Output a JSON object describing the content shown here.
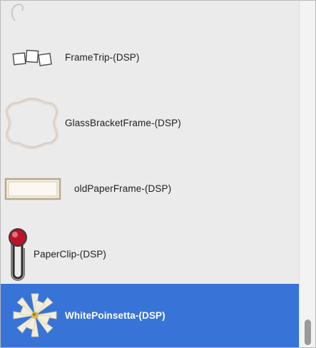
{
  "list": {
    "items": [
      {
        "label": "FrameTrip-(DSP)",
        "icon": "frame-trip-icon",
        "selected": false
      },
      {
        "label": "GlassBracketFrame-(DSP)",
        "icon": "glass-bracket-frame-icon",
        "selected": false
      },
      {
        "label": "oldPaperFrame-(DSP)",
        "icon": "old-paper-frame-icon",
        "selected": false
      },
      {
        "label": "PaperClip-(DSP)",
        "icon": "paper-clip-icon",
        "selected": false
      },
      {
        "label": "WhitePoinsetta-(DSP)",
        "icon": "white-poinsetta-icon",
        "selected": true
      }
    ]
  },
  "colors": {
    "selection": "#3874d8",
    "panel_background": "#ebebeb"
  }
}
